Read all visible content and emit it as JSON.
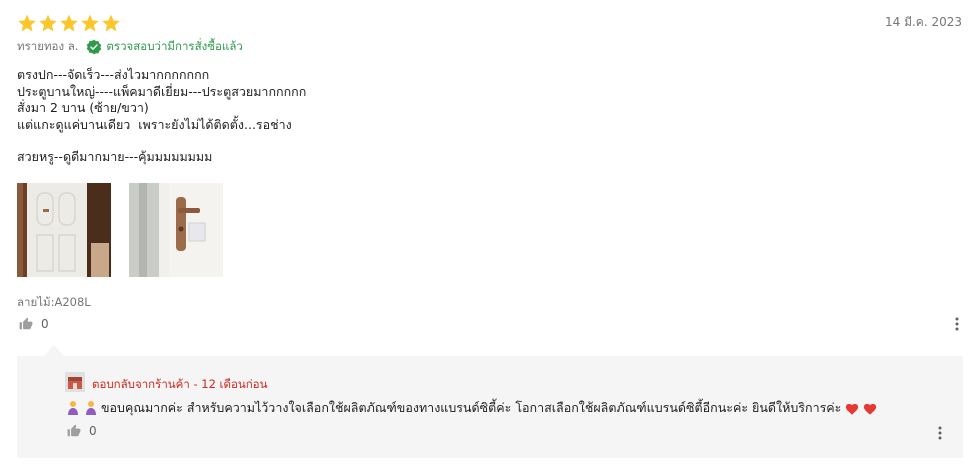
{
  "review": {
    "rating": 5,
    "max_rating": 5,
    "date": "14 มี.ค. 2023",
    "reviewer_name": "ทรายทอง ล.",
    "verified_text": "ตรวจสอบว่ามีการสั่งซื้อแล้ว",
    "body_lines": [
      "ตรงปก---จัดเร็ว---ส่งไวมากกกกกกก",
      "ประตูบานใหญ่----แพ็คมาดีเยี่ยม---ประตูสวยมากกกกก",
      "สั่งมา 2 บาน (ซ้าย/ขวา)",
      "แต่แกะดูแค่บานเดียว  เพราะยังไม่ได้ติดตั้ง...รอช่าง"
    ],
    "body_extra": "สวยหรู--ดูดีมากมาย---คุ้มมมมมมมม",
    "photos": [
      {
        "name": "door-panel-photo"
      },
      {
        "name": "door-handle-photo"
      }
    ],
    "variant": "ลายไม้:A208L",
    "likes": "0"
  },
  "reply": {
    "header": "ตอบกลับจากร้านค้า - 12 เดือนก่อน",
    "text": "ขอบคุณมากค่ะ สำหรับความไว้วางใจเลือกใช้ผลิตภัณฑ์ของทางแบรนด์ซิตี้ค่ะ โอกาสเลือกใช้ผลิตภัณฑ์แบรนด์ซิตี้อีกนะค่ะ ยินดีให้บริการค่ะ",
    "likes": "0"
  },
  "colors": {
    "star": "#fcc72c",
    "verified": "#2e9b4a",
    "shop_reply": "#d0281f",
    "reply_bg": "#f5f5f5",
    "heart": "#e53935"
  },
  "icons": [
    "star-icon",
    "verified-check-icon",
    "thumbs-up-icon",
    "more-vert-icon",
    "shop-icon",
    "praying-hands-emoji",
    "heart-emoji"
  ]
}
